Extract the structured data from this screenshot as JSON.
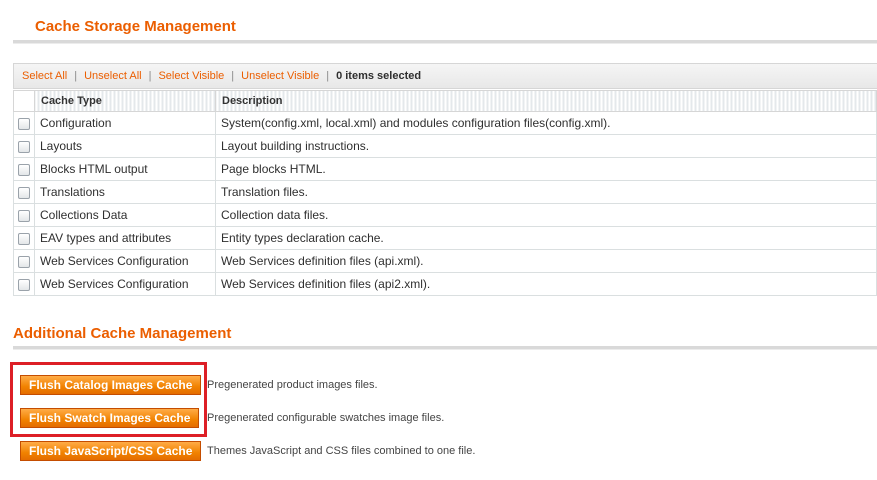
{
  "cache_storage": {
    "title": "Cache Storage Management",
    "mass_actions": {
      "select_all": "Select All",
      "unselect_all": "Unselect All",
      "select_visible": "Select Visible",
      "unselect_visible": "Unselect Visible",
      "separator": "|",
      "items_selected": "0 items selected"
    },
    "columns": {
      "cache_type": "Cache Type",
      "description": "Description"
    },
    "rows": [
      {
        "type": "Configuration",
        "description": "System(config.xml, local.xml) and modules configuration files(config.xml)."
      },
      {
        "type": "Layouts",
        "description": "Layout building instructions."
      },
      {
        "type": "Blocks HTML output",
        "description": "Page blocks HTML."
      },
      {
        "type": "Translations",
        "description": "Translation files."
      },
      {
        "type": "Collections Data",
        "description": "Collection data files."
      },
      {
        "type": "EAV types and attributes",
        "description": "Entity types declaration cache."
      },
      {
        "type": "Web Services Configuration",
        "description": "Web Services definition files (api.xml)."
      },
      {
        "type": "Web Services Configuration",
        "description": "Web Services definition files (api2.xml)."
      }
    ]
  },
  "additional_cache": {
    "title": "Additional Cache Management",
    "buttons": [
      {
        "label": "Flush Catalog Images Cache",
        "description": "Pregenerated product images files."
      },
      {
        "label": "Flush Swatch Images Cache",
        "description": "Pregenerated configurable swatches image files."
      },
      {
        "label": "Flush JavaScript/CSS Cache",
        "description": "Themes JavaScript and CSS files combined to one file."
      }
    ]
  },
  "colors": {
    "accent": "#eb5e00",
    "button": "#f18200",
    "highlight": "#dd1f26"
  }
}
